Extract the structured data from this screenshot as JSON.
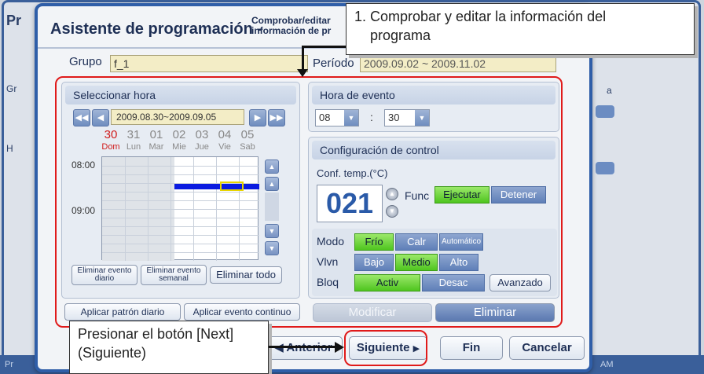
{
  "background": {
    "title": "Pr",
    "left_labels": [
      "Gr",
      "H"
    ],
    "right_label": "a",
    "bottom_left": "Pr",
    "bottom_right": "AM"
  },
  "dialog": {
    "title": "Asistente de programación -",
    "subtitle_line1": "Comprobar/editar",
    "subtitle_line2": "información de pr",
    "group_label": "Grupo",
    "group_value": "f_1",
    "period_label": "Período",
    "period_value": "2009.09.02 ~ 2009.11.02"
  },
  "select_hour": {
    "title": "Seleccionar hora",
    "date_range": "2009.08.30~2009.09.05",
    "days": [
      {
        "num": "30",
        "name": "Dom",
        "highlight": true
      },
      {
        "num": "31",
        "name": "Lun",
        "highlight": false
      },
      {
        "num": "01",
        "name": "Mar",
        "highlight": false
      },
      {
        "num": "02",
        "name": "Mie",
        "highlight": false
      },
      {
        "num": "03",
        "name": "Jue",
        "highlight": false
      },
      {
        "num": "04",
        "name": "Vie",
        "highlight": false
      },
      {
        "num": "05",
        "name": "Sab",
        "highlight": false
      }
    ],
    "time_labels": [
      "08:00",
      "09:00"
    ],
    "btn_delete_daily": "Eliminar evento diario",
    "btn_delete_daily_l1": "Eliminar evento",
    "btn_delete_daily_l2": "diario",
    "btn_delete_weekly_l1": "Eliminar evento",
    "btn_delete_weekly_l2": "semanal",
    "btn_delete_all": "Eliminar todo",
    "btn_apply_daily": "Aplicar patrón diario",
    "btn_apply_continuous": "Aplicar evento continuo"
  },
  "event_hour": {
    "title": "Hora de evento",
    "hour": "08",
    "separator": ":",
    "minute": "30"
  },
  "control": {
    "title": "Configuración de control",
    "temp_label": "Conf. temp.(°C)",
    "temp_value": "021",
    "func_label": "Func",
    "func_options": [
      "Ejecutar",
      "Detener"
    ],
    "func_selected": "Ejecutar",
    "mode_label": "Modo",
    "mode_options": [
      "Frío",
      "Calr",
      "Automático"
    ],
    "mode_selected": "Frío",
    "fan_label": "Vlvn",
    "fan_options": [
      "Bajo",
      "Medio",
      "Alto"
    ],
    "fan_selected": "Medio",
    "lock_label": "Bloq",
    "lock_options": [
      "Activ",
      "Desac"
    ],
    "lock_selected": "Activ",
    "advanced": "Avanzado"
  },
  "actions": {
    "modify": "Modificar",
    "delete": "Eliminar"
  },
  "footer": {
    "prev": "◀ Anterior",
    "next": "Siguiente",
    "finish": "Fin",
    "cancel": "Cancelar"
  },
  "annotations": {
    "callout_top_l1": "1. Comprobar y editar la información del",
    "callout_top_l2": "programa",
    "callout_bottom_l1": "Presionar el botón [Next]",
    "callout_bottom_l2": "(Siguiente)"
  },
  "colors": {
    "accent": "#2f5ea8",
    "selected_green": "#4fc51f",
    "annotation_red": "#e01a1a",
    "event_blue": "#0a1be0",
    "day_highlight": "#d01a1a"
  }
}
